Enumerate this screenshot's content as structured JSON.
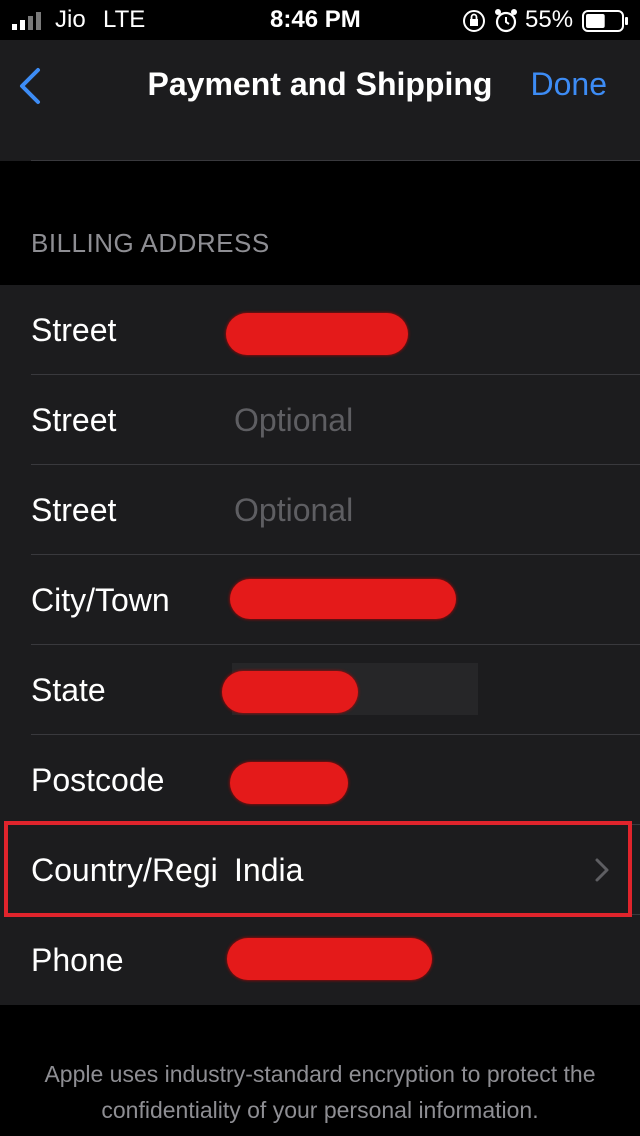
{
  "status_bar": {
    "carrier": "Jio",
    "network": "LTE",
    "time": "8:46 PM",
    "battery": "55%",
    "battery_level": 0.55
  },
  "nav": {
    "back_icon": "chevron-left-icon",
    "title": "Payment and Shipping",
    "done_label": "Done"
  },
  "accent_color": "#3d8cf5",
  "billing": {
    "header": "BILLING ADDRESS",
    "rows": [
      {
        "label": "Street",
        "value": "",
        "placeholder": ""
      },
      {
        "label": "Street",
        "value": "",
        "placeholder": "Optional"
      },
      {
        "label": "Street",
        "value": "",
        "placeholder": "Optional"
      },
      {
        "label": "City/Town",
        "value": "",
        "placeholder": ""
      },
      {
        "label": "State",
        "value": "",
        "placeholder": ""
      },
      {
        "label": "Postcode",
        "value": "",
        "placeholder": ""
      },
      {
        "label": "Country/Regi",
        "value": "India",
        "placeholder": ""
      },
      {
        "label": "Phone",
        "value": "",
        "placeholder": ""
      }
    ]
  },
  "footer": "Apple uses industry-standard encryption to protect the confidentiality of your personal information."
}
